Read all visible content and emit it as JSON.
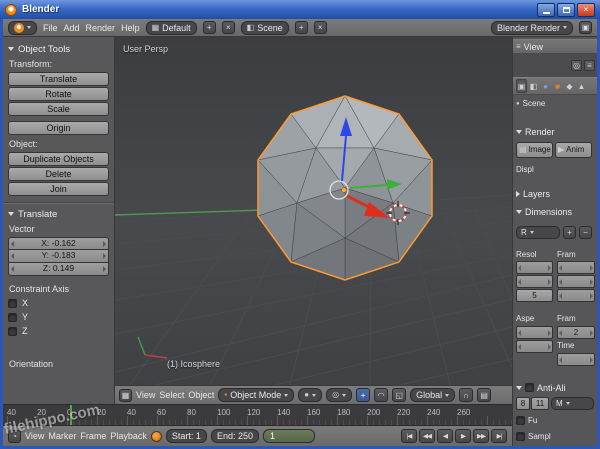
{
  "window": {
    "title": "Blender",
    "close_glyph": "×"
  },
  "icons": {
    "layout": "▦",
    "scene_tab": "◧",
    "add": "+",
    "close": "×",
    "window": "▣",
    "editor_3d": "▦",
    "mode_cube": "▪",
    "shading_sphere": "●",
    "pivot_center": "◎",
    "manip_translate": "+",
    "manip_rotate": "◠",
    "manip_scale": "◱",
    "magnet": "∩",
    "render_camera": "▤",
    "outliner_menu": "≡",
    "filter": "◎",
    "clock": "◔",
    "jump_start": "|◀",
    "step_back": "◀◀",
    "play_reverse": "◀",
    "play": "▶",
    "step_forward": "▶▶",
    "jump_end": "▶|",
    "tab_render": "▣",
    "tab_scene": "◧",
    "tab_world": "●",
    "tab_object": "■",
    "tab_constraints": "◆",
    "tab_data": "▲",
    "scene_dot": "●",
    "minus": "−"
  },
  "infobar": {
    "menus": [
      "File",
      "Add",
      "Render",
      "Help"
    ],
    "layout_value": "Default",
    "scene_value": "Scene",
    "engine_value": "Blender Render"
  },
  "toolshelf": {
    "title": "Object Tools",
    "transform_label": "Transform:",
    "buttons": {
      "translate": "Translate",
      "rotate": "Rotate",
      "scale": "Scale",
      "origin": "Origin",
      "duplicate": "Duplicate Objects",
      "delete": "Delete",
      "join": "Join"
    },
    "object_label": "Object:",
    "translate_panel": {
      "title": "Translate",
      "vector_label": "Vector",
      "x": "X: -0.162",
      "y": "Y: -0.183",
      "z": "Z: 0.149",
      "constraint_label": "Constraint Axis",
      "axis_x": "X",
      "axis_y": "Y",
      "axis_z": "Z"
    },
    "orientation_label": "Orientation"
  },
  "viewport": {
    "view_label": "User Persp",
    "object_label": "(1) Icosphere",
    "header": {
      "menus": [
        "View",
        "Select",
        "Object"
      ],
      "mode": "Object Mode",
      "orientation": "Global"
    }
  },
  "outliner": {
    "menu": "View"
  },
  "properties": {
    "breadcrumb": "Scene",
    "render_title": "Render",
    "image_button": "Image",
    "anim_button": "Anim",
    "display_label": "Displ",
    "layers_title": "Layers",
    "dimensions_title": "Dimensions",
    "preset_value": "R",
    "resolution_label": "Resol",
    "frame_range_label": "Fram",
    "percent_button": "5",
    "aspect_label": "Aspe",
    "framerate_label": "Fram",
    "framerate_value": "2",
    "time_label": "Time",
    "aa_title": "Anti-Ali",
    "aa_sample_a": "8",
    "aa_sample_b": "11",
    "aa_filter": "M",
    "full_sample_label": "Fu",
    "sampled_label": "Sampl"
  },
  "timeline": {
    "ruler": [
      "40",
      "20",
      "0",
      "20",
      "40",
      "60",
      "80",
      "100",
      "120",
      "140",
      "160",
      "180",
      "200",
      "220",
      "240",
      "260"
    ],
    "menus": [
      "View",
      "Marker",
      "Frame",
      "Playback"
    ],
    "start_value": "Start: 1",
    "end_value": "End: 250",
    "frame_value": "1"
  },
  "watermark": "filehippo.com"
}
